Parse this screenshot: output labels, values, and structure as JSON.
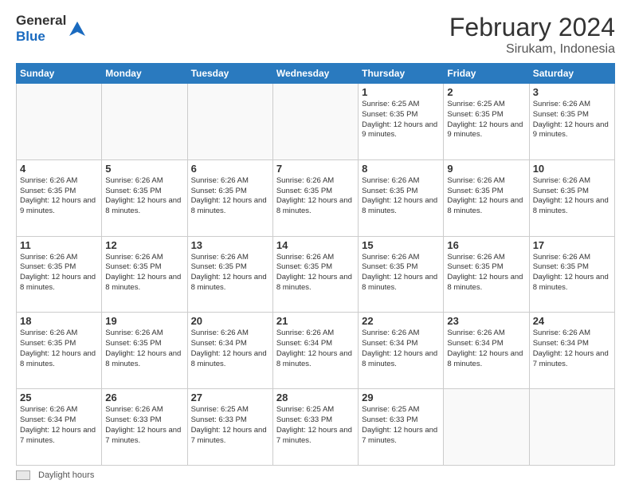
{
  "header": {
    "logo_general": "General",
    "logo_blue": "Blue",
    "month": "February 2024",
    "location": "Sirukam, Indonesia"
  },
  "days_of_week": [
    "Sunday",
    "Monday",
    "Tuesday",
    "Wednesday",
    "Thursday",
    "Friday",
    "Saturday"
  ],
  "weeks": [
    [
      {
        "day": "",
        "sunrise": "",
        "sunset": "",
        "daylight": ""
      },
      {
        "day": "",
        "sunrise": "",
        "sunset": "",
        "daylight": ""
      },
      {
        "day": "",
        "sunrise": "",
        "sunset": "",
        "daylight": ""
      },
      {
        "day": "",
        "sunrise": "",
        "sunset": "",
        "daylight": ""
      },
      {
        "day": "1",
        "sunrise": "Sunrise: 6:25 AM",
        "sunset": "Sunset: 6:35 PM",
        "daylight": "Daylight: 12 hours and 9 minutes."
      },
      {
        "day": "2",
        "sunrise": "Sunrise: 6:25 AM",
        "sunset": "Sunset: 6:35 PM",
        "daylight": "Daylight: 12 hours and 9 minutes."
      },
      {
        "day": "3",
        "sunrise": "Sunrise: 6:26 AM",
        "sunset": "Sunset: 6:35 PM",
        "daylight": "Daylight: 12 hours and 9 minutes."
      }
    ],
    [
      {
        "day": "4",
        "sunrise": "Sunrise: 6:26 AM",
        "sunset": "Sunset: 6:35 PM",
        "daylight": "Daylight: 12 hours and 9 minutes."
      },
      {
        "day": "5",
        "sunrise": "Sunrise: 6:26 AM",
        "sunset": "Sunset: 6:35 PM",
        "daylight": "Daylight: 12 hours and 8 minutes."
      },
      {
        "day": "6",
        "sunrise": "Sunrise: 6:26 AM",
        "sunset": "Sunset: 6:35 PM",
        "daylight": "Daylight: 12 hours and 8 minutes."
      },
      {
        "day": "7",
        "sunrise": "Sunrise: 6:26 AM",
        "sunset": "Sunset: 6:35 PM",
        "daylight": "Daylight: 12 hours and 8 minutes."
      },
      {
        "day": "8",
        "sunrise": "Sunrise: 6:26 AM",
        "sunset": "Sunset: 6:35 PM",
        "daylight": "Daylight: 12 hours and 8 minutes."
      },
      {
        "day": "9",
        "sunrise": "Sunrise: 6:26 AM",
        "sunset": "Sunset: 6:35 PM",
        "daylight": "Daylight: 12 hours and 8 minutes."
      },
      {
        "day": "10",
        "sunrise": "Sunrise: 6:26 AM",
        "sunset": "Sunset: 6:35 PM",
        "daylight": "Daylight: 12 hours and 8 minutes."
      }
    ],
    [
      {
        "day": "11",
        "sunrise": "Sunrise: 6:26 AM",
        "sunset": "Sunset: 6:35 PM",
        "daylight": "Daylight: 12 hours and 8 minutes."
      },
      {
        "day": "12",
        "sunrise": "Sunrise: 6:26 AM",
        "sunset": "Sunset: 6:35 PM",
        "daylight": "Daylight: 12 hours and 8 minutes."
      },
      {
        "day": "13",
        "sunrise": "Sunrise: 6:26 AM",
        "sunset": "Sunset: 6:35 PM",
        "daylight": "Daylight: 12 hours and 8 minutes."
      },
      {
        "day": "14",
        "sunrise": "Sunrise: 6:26 AM",
        "sunset": "Sunset: 6:35 PM",
        "daylight": "Daylight: 12 hours and 8 minutes."
      },
      {
        "day": "15",
        "sunrise": "Sunrise: 6:26 AM",
        "sunset": "Sunset: 6:35 PM",
        "daylight": "Daylight: 12 hours and 8 minutes."
      },
      {
        "day": "16",
        "sunrise": "Sunrise: 6:26 AM",
        "sunset": "Sunset: 6:35 PM",
        "daylight": "Daylight: 12 hours and 8 minutes."
      },
      {
        "day": "17",
        "sunrise": "Sunrise: 6:26 AM",
        "sunset": "Sunset: 6:35 PM",
        "daylight": "Daylight: 12 hours and 8 minutes."
      }
    ],
    [
      {
        "day": "18",
        "sunrise": "Sunrise: 6:26 AM",
        "sunset": "Sunset: 6:35 PM",
        "daylight": "Daylight: 12 hours and 8 minutes."
      },
      {
        "day": "19",
        "sunrise": "Sunrise: 6:26 AM",
        "sunset": "Sunset: 6:35 PM",
        "daylight": "Daylight: 12 hours and 8 minutes."
      },
      {
        "day": "20",
        "sunrise": "Sunrise: 6:26 AM",
        "sunset": "Sunset: 6:34 PM",
        "daylight": "Daylight: 12 hours and 8 minutes."
      },
      {
        "day": "21",
        "sunrise": "Sunrise: 6:26 AM",
        "sunset": "Sunset: 6:34 PM",
        "daylight": "Daylight: 12 hours and 8 minutes."
      },
      {
        "day": "22",
        "sunrise": "Sunrise: 6:26 AM",
        "sunset": "Sunset: 6:34 PM",
        "daylight": "Daylight: 12 hours and 8 minutes."
      },
      {
        "day": "23",
        "sunrise": "Sunrise: 6:26 AM",
        "sunset": "Sunset: 6:34 PM",
        "daylight": "Daylight: 12 hours and 8 minutes."
      },
      {
        "day": "24",
        "sunrise": "Sunrise: 6:26 AM",
        "sunset": "Sunset: 6:34 PM",
        "daylight": "Daylight: 12 hours and 7 minutes."
      }
    ],
    [
      {
        "day": "25",
        "sunrise": "Sunrise: 6:26 AM",
        "sunset": "Sunset: 6:34 PM",
        "daylight": "Daylight: 12 hours and 7 minutes."
      },
      {
        "day": "26",
        "sunrise": "Sunrise: 6:26 AM",
        "sunset": "Sunset: 6:33 PM",
        "daylight": "Daylight: 12 hours and 7 minutes."
      },
      {
        "day": "27",
        "sunrise": "Sunrise: 6:25 AM",
        "sunset": "Sunset: 6:33 PM",
        "daylight": "Daylight: 12 hours and 7 minutes."
      },
      {
        "day": "28",
        "sunrise": "Sunrise: 6:25 AM",
        "sunset": "Sunset: 6:33 PM",
        "daylight": "Daylight: 12 hours and 7 minutes."
      },
      {
        "day": "29",
        "sunrise": "Sunrise: 6:25 AM",
        "sunset": "Sunset: 6:33 PM",
        "daylight": "Daylight: 12 hours and 7 minutes."
      },
      {
        "day": "",
        "sunrise": "",
        "sunset": "",
        "daylight": ""
      },
      {
        "day": "",
        "sunrise": "",
        "sunset": "",
        "daylight": ""
      }
    ]
  ],
  "footer": {
    "swatch_label": "Daylight hours"
  }
}
